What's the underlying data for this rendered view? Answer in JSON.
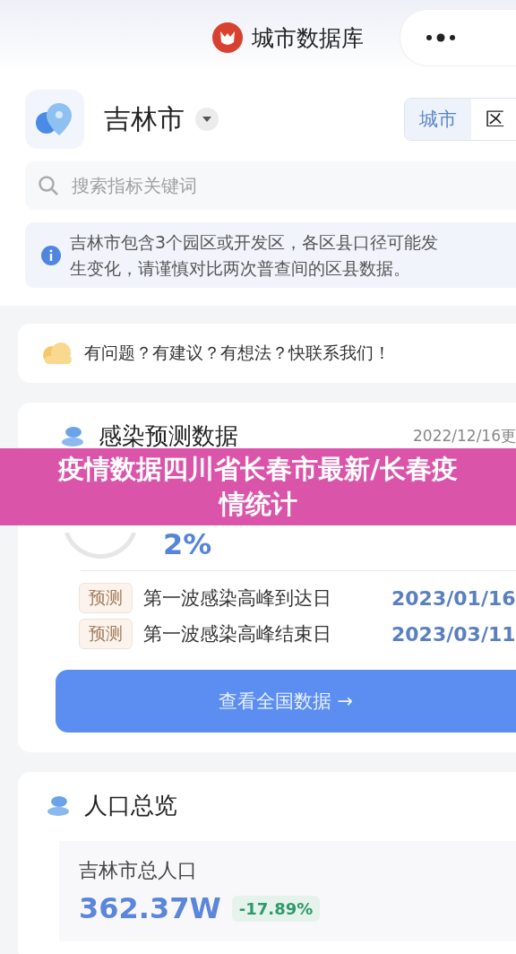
{
  "top_bar": {
    "title": "城市数据库"
  },
  "city": {
    "name": "吉林市"
  },
  "scope_tabs": [
    {
      "label": "城市",
      "selected": true
    },
    {
      "label": "区",
      "selected": false
    }
  ],
  "search": {
    "placeholder": "搜索指标关键词"
  },
  "notice_lines": [
    "吉林市包含3个园区或开发区，各区县口径可能发",
    "生变化，请谨慎对比两次普查间的区县数据。"
  ],
  "feedback": "有问题？有建议？有想法？快联系我们！",
  "forecast_card": {
    "title": "感染预测数据",
    "date": "2022/12/16更",
    "progress": {
      "value": "2%"
    },
    "rows": [
      {
        "tag": "预测",
        "label": "第一波感染高峰到达日",
        "date": "2023/01/16"
      },
      {
        "tag": "预测",
        "label": "第一波感染高峰结束日",
        "date": "2023/03/11"
      }
    ],
    "button": "查看全国数据 →"
  },
  "population_card": {
    "title": "人口总览",
    "label": "吉林市总人口",
    "value": "362.37W",
    "change": "-17.89%"
  },
  "overlay_banner": "疫情数据四川省长春市最新/长春疫情统计"
}
